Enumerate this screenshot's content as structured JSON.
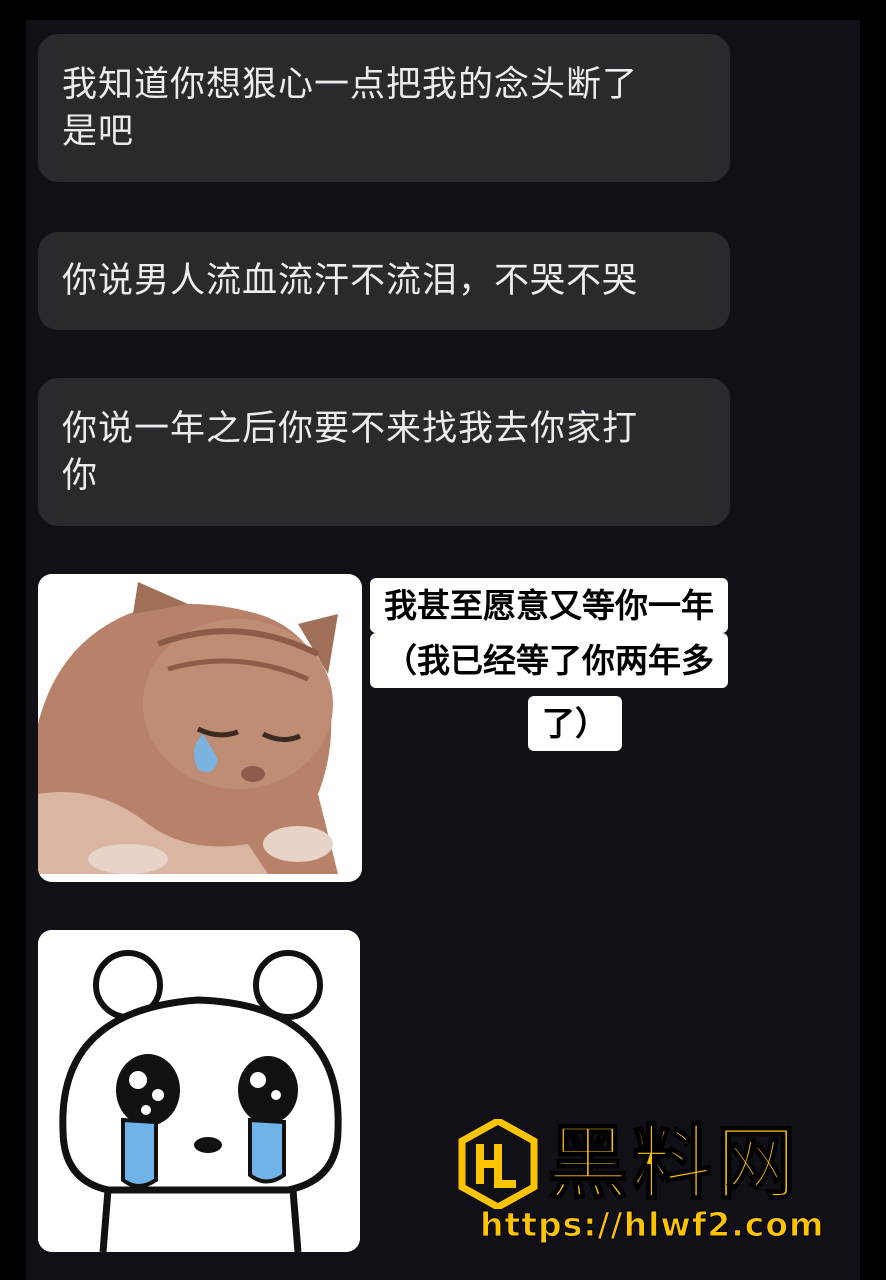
{
  "messages": [
    {
      "lines": [
        "我知道你想狠心一点把我的念头断了",
        "是吧"
      ]
    },
    {
      "lines": [
        "你说男人流血流汗不流泪，不哭不哭"
      ]
    },
    {
      "lines": [
        "你说一年之后你要不来找我去你家打",
        "你"
      ]
    }
  ],
  "sticker_caption": {
    "lines": [
      "我甚至愿意又等你一年",
      "（我已经等了你两年多",
      "了）"
    ]
  },
  "stickers": [
    {
      "icon": "crying-cat-sticker"
    },
    {
      "icon": "crying-bear-sticker"
    }
  ],
  "watermark": {
    "brand": "黑料网",
    "url": "https://hlwf2.com",
    "color": "#ffc400"
  },
  "colors": {
    "background": "#111016",
    "bubble": "#2a2a2e",
    "bubble_text": "#ececec"
  }
}
